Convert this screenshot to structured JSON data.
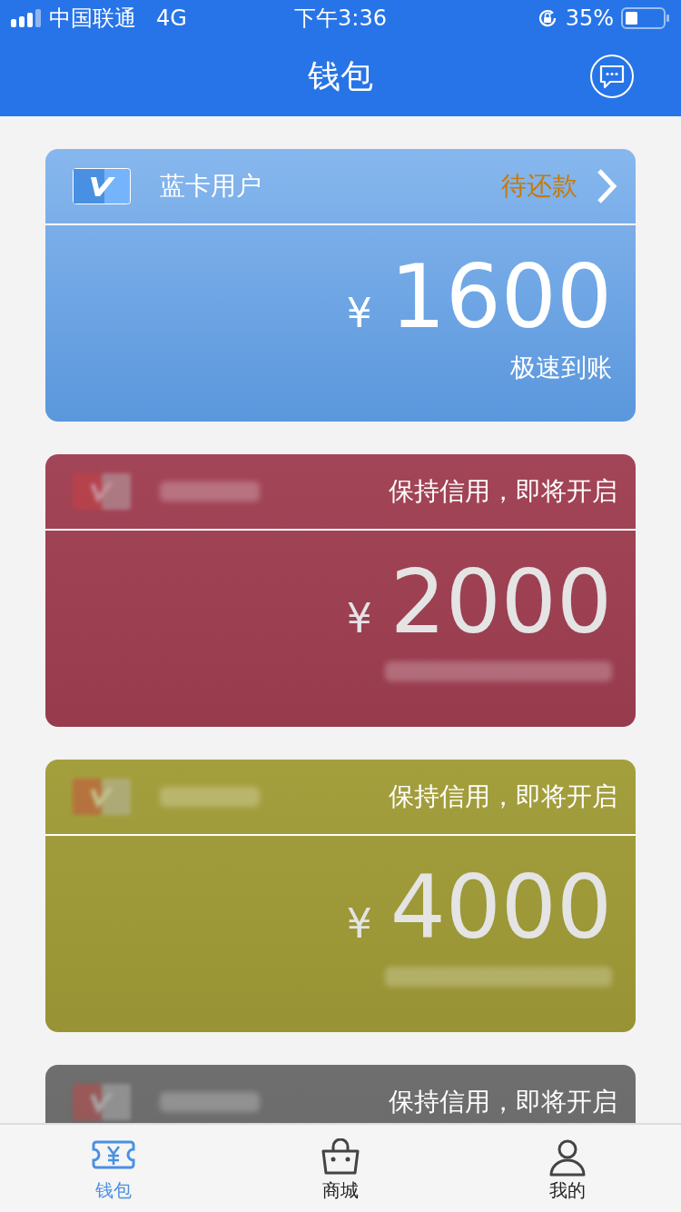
{
  "status_bar": {
    "carrier": "中国联通",
    "network": "4G",
    "time": "下午3:36",
    "battery": "35%"
  },
  "nav": {
    "title": "钱包"
  },
  "cards": [
    {
      "color": "#5f9fe8",
      "locked": false,
      "name": "蓝卡用户",
      "status": "待还款",
      "currency": "¥",
      "amount": "1600",
      "subtitle": "极速到账"
    },
    {
      "color": "#a03f52",
      "locked": true,
      "status": "保持信用，即将开启",
      "currency": "¥",
      "amount": "2000"
    },
    {
      "color": "#a19c37",
      "locked": true,
      "status": "保持信用，即将开启",
      "currency": "¥",
      "amount": "4000"
    },
    {
      "color": "#6a6a6a",
      "locked": true,
      "status": "保持信用，即将开启"
    }
  ],
  "tabs": [
    {
      "kind": "wallet",
      "label": "钱包",
      "selected": true
    },
    {
      "kind": "shop",
      "label": "商城",
      "selected": false
    },
    {
      "kind": "profile",
      "label": "我的",
      "selected": false
    }
  ]
}
